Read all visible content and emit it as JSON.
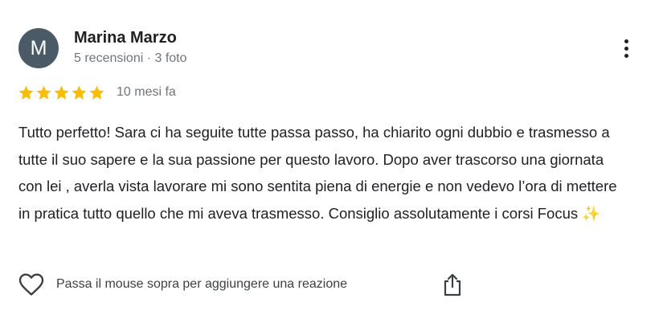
{
  "review": {
    "author": {
      "initial": "M",
      "name": "Marina Marzo",
      "meta": "5 recensioni · 3 foto",
      "avatar_color": "#4a5a66"
    },
    "rating": {
      "stars": 5,
      "max_stars": 5,
      "star_color": "#fbbc04"
    },
    "date": "10 mesi fa",
    "text": "Tutto perfetto! Sara ci ha seguite tutte passa passo, ha chiarito ogni dubbio e trasmesso a tutte il suo sapere e la sua passione per questo lavoro. Dopo aver trascorso una giornata con lei , averla vista lavorare mi sono sentita piena di energie e non vedevo l’ora di mettere in pratica tutto quello che mi aveva trasmesso. Consiglio assolutamente i corsi Focus",
    "text_emoji": "✨",
    "actions": {
      "reaction_hint": "Passa il mouse sopra per aggiungere una reazione",
      "more_icon": "more-vertical-icon",
      "heart_icon": "heart-outline-icon",
      "share_icon": "share-icon"
    }
  }
}
